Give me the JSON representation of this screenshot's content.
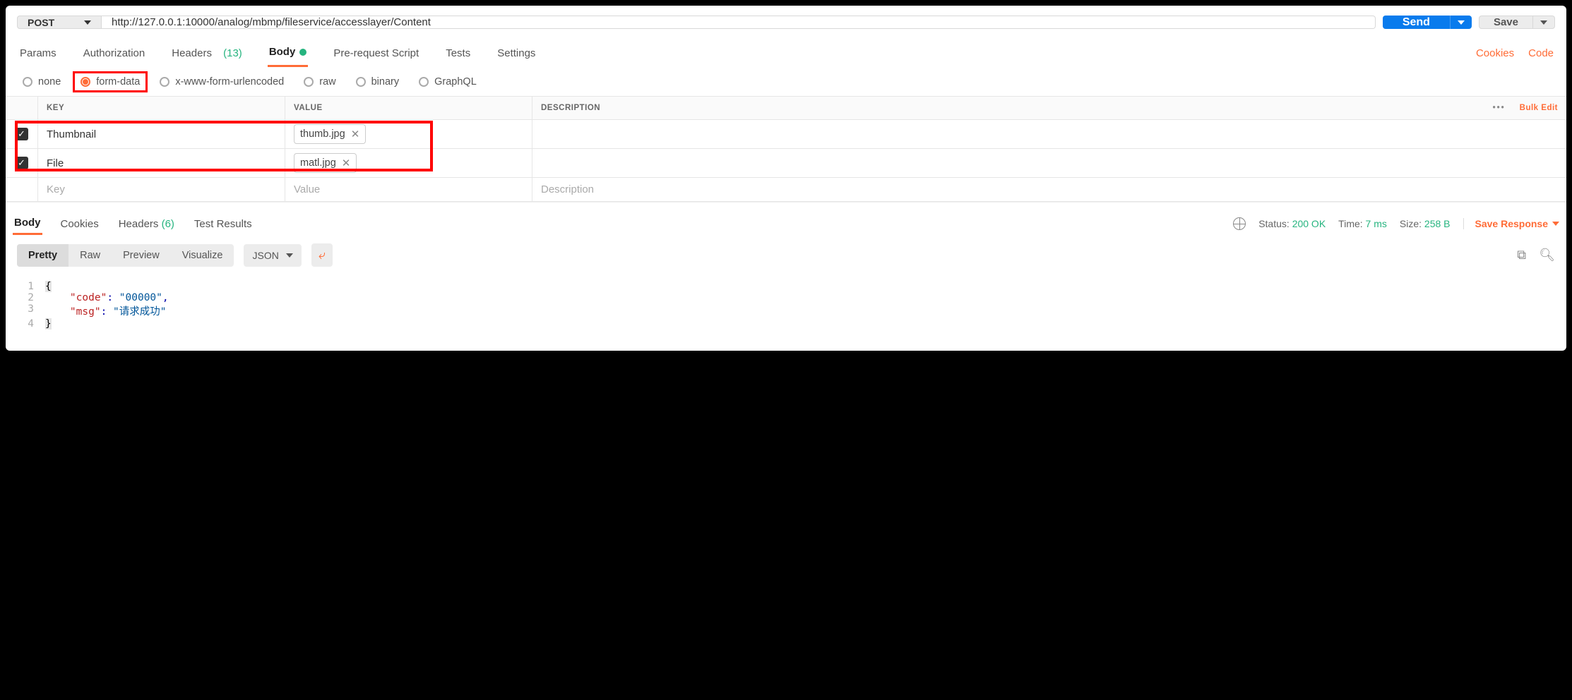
{
  "request": {
    "method": "POST",
    "url": "http://127.0.0.1:10000/analog/mbmp/fileservice/accesslayer/Content",
    "send_label": "Send",
    "save_label": "Save"
  },
  "tabs": {
    "params": "Params",
    "authorization": "Authorization",
    "headers": "Headers",
    "headers_count": "(13)",
    "body": "Body",
    "prerequest": "Pre-request Script",
    "tests": "Tests",
    "settings": "Settings",
    "cookies_link": "Cookies",
    "code_link": "Code"
  },
  "body_types": {
    "none": "none",
    "formdata": "form-data",
    "urlencoded": "x-www-form-urlencoded",
    "raw": "raw",
    "binary": "binary",
    "graphql": "GraphQL"
  },
  "fd": {
    "hdr_key": "KEY",
    "hdr_value": "VALUE",
    "hdr_desc": "DESCRIPTION",
    "bulk_edit": "Bulk Edit",
    "rows": [
      {
        "key": "Thumbnail",
        "file": "thumb.jpg"
      },
      {
        "key": "File",
        "file": "matl.jpg"
      }
    ],
    "ph_key": "Key",
    "ph_value": "Value",
    "ph_desc": "Description"
  },
  "response": {
    "tabs": {
      "body": "Body",
      "cookies": "Cookies",
      "headers": "Headers",
      "headers_count": "(6)",
      "testresults": "Test Results"
    },
    "status_label": "Status:",
    "status_value": "200 OK",
    "time_label": "Time:",
    "time_value": "7 ms",
    "size_label": "Size:",
    "size_value": "258 B",
    "save_response": "Save Response",
    "views": {
      "pretty": "Pretty",
      "raw": "Raw",
      "preview": "Preview",
      "visualize": "Visualize"
    },
    "format": "JSON",
    "json": {
      "code_key": "\"code\"",
      "code_val": "\"00000\"",
      "msg_key": "\"msg\"",
      "msg_val": "\"请求成功\""
    }
  }
}
